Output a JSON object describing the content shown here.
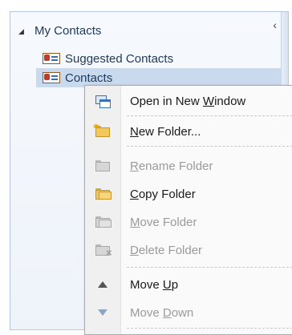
{
  "folder_pane": {
    "title": "My Contacts",
    "items": [
      {
        "label": "Suggested Contacts"
      },
      {
        "label": "Contacts"
      }
    ]
  },
  "context_menu": {
    "items": [
      {
        "pre": "Open in New ",
        "key": "W",
        "post": "indow",
        "disabled": false,
        "icon": "open-window-icon"
      },
      {
        "pre": "",
        "key": "N",
        "post": "ew Folder...",
        "disabled": false,
        "icon": "new-folder-icon"
      },
      {
        "pre": "",
        "key": "R",
        "post": "ename Folder",
        "disabled": true,
        "icon": "rename-folder-icon"
      },
      {
        "pre": "",
        "key": "C",
        "post": "opy Folder",
        "disabled": false,
        "icon": "copy-folder-icon"
      },
      {
        "pre": "",
        "key": "M",
        "post": "ove Folder",
        "disabled": true,
        "icon": "move-folder-icon"
      },
      {
        "pre": "",
        "key": "D",
        "post": "elete Folder",
        "disabled": true,
        "icon": "delete-folder-icon"
      },
      {
        "pre": "Move ",
        "key": "U",
        "post": "p",
        "disabled": false,
        "icon": "move-up-icon"
      },
      {
        "pre": "Move ",
        "key": "D",
        "post": "own",
        "disabled": true,
        "icon": "move-down-icon"
      }
    ]
  }
}
